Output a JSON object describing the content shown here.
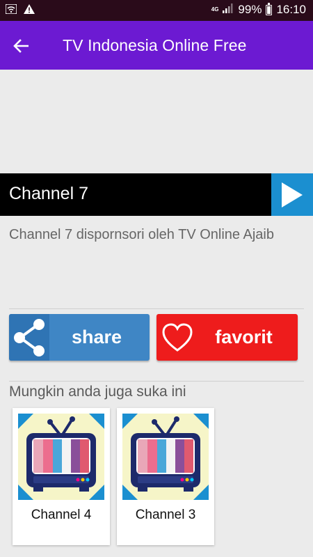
{
  "status_bar": {
    "network": "4G",
    "battery": "99%",
    "time": "16:10"
  },
  "app_bar": {
    "title": "TV Indonesia Online Free"
  },
  "player": {
    "channel": "Channel 7"
  },
  "description": "Channel 7 dispornsori oleh TV Online Ajaib",
  "actions": {
    "share_label": "share",
    "favorite_label": "favorit"
  },
  "suggestions": {
    "title": "Mungkin anda juga suka ini",
    "items": [
      {
        "label": "Channel 4"
      },
      {
        "label": "Channel 3"
      }
    ]
  },
  "colors": {
    "app_bar": "#6c1ad2",
    "share": "#3f86c5",
    "favorite": "#ee1c1c",
    "play": "#1b8fd0"
  }
}
